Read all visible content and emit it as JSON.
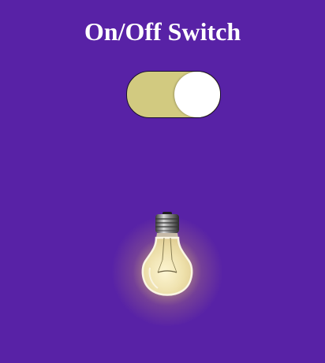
{
  "title": "On/Off Switch",
  "toggle": {
    "state": "on",
    "track_color": "#d2ca80",
    "knob_color": "#ffffff"
  },
  "bulb": {
    "icon": "light-bulb-icon",
    "lit": true,
    "glow_color": "#f5e7a0"
  },
  "colors": {
    "background": "#5822a6",
    "text": "#ffffff"
  }
}
